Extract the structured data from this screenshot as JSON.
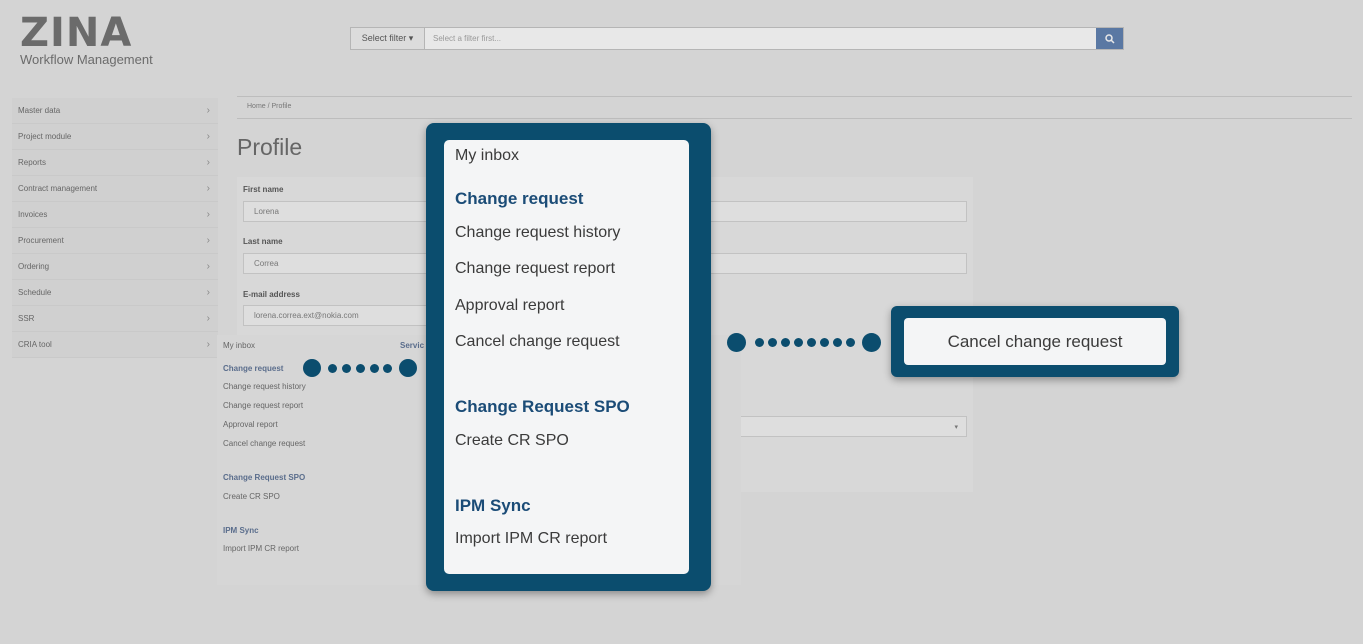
{
  "app": {
    "logo_text": "ZINA",
    "logo_subtitle": "Workflow Management"
  },
  "search": {
    "filter_label": "Select filter ▾",
    "placeholder": "Select a filter first...",
    "button_icon": "search-icon"
  },
  "breadcrumb": {
    "text": "Home  /  Profile"
  },
  "page": {
    "title": "Profile"
  },
  "sidebar": {
    "items": [
      {
        "label": "Master data"
      },
      {
        "label": "Project module"
      },
      {
        "label": "Reports"
      },
      {
        "label": "Contract management"
      },
      {
        "label": "Invoices"
      },
      {
        "label": "Procurement"
      },
      {
        "label": "Ordering"
      },
      {
        "label": "Schedule"
      },
      {
        "label": "SSR"
      },
      {
        "label": "CRIA tool"
      }
    ]
  },
  "form": {
    "first_name_label": "First name",
    "first_name_value": "Lorena",
    "last_name_label": "Last name",
    "last_name_value": "Correa",
    "email_label": "E-mail address",
    "email_value": "lorena.correa.ext@nokia.com"
  },
  "ghost_menu": {
    "inbox": "My inbox",
    "change_request_head": "Change request",
    "items": [
      "Change request history",
      "Change request report",
      "Approval report",
      "Cancel change request"
    ],
    "spo_head": "Change Request SPO",
    "spo_item": "Create CR SPO",
    "ipm_head": "IPM Sync",
    "ipm_item": "Import IPM CR report",
    "col2_head": "Servic"
  },
  "popup": {
    "inbox": "My inbox",
    "change_request_head": "Change request",
    "items": [
      "Change request history",
      "Change request report",
      "Approval report",
      "Cancel change request"
    ],
    "spo_head": "Change Request SPO",
    "spo_item": "Create CR SPO",
    "ipm_head": "IPM Sync",
    "ipm_item": "Import IPM CR report"
  },
  "callout": {
    "label": "Cancel change request"
  },
  "colors": {
    "accent": "#0b4d6e",
    "heading_blue": "#1b4c77",
    "background": "#d4d4d4"
  }
}
